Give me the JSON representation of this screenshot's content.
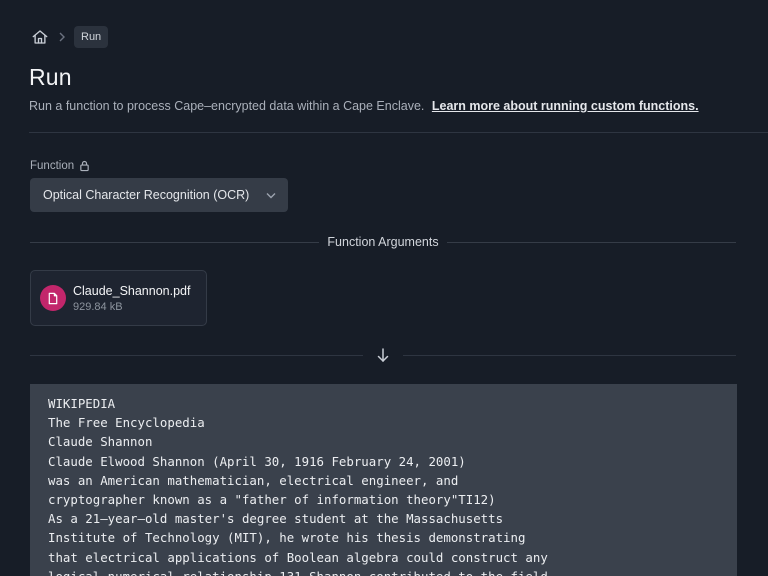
{
  "breadcrumb": {
    "current": "Run"
  },
  "header": {
    "title": "Run",
    "subtitle": "Run a function to process Cape–encrypted data within a Cape Enclave.",
    "learn_more_link": "Learn more about running custom functions."
  },
  "function_field": {
    "label": "Function",
    "selected": "Optical Character Recognition (OCR)"
  },
  "arguments": {
    "section_label": "Function Arguments",
    "file": {
      "name": "Claude_Shannon.pdf",
      "size": "929.84 kB"
    }
  },
  "output": {
    "lines": [
      "WIKIPEDIA",
      "The Free Encyclopedia",
      "Claude Shannon",
      "Claude Elwood Shannon (April 30, 1916 February 24, 2001)",
      "was an American mathematician, electrical engineer, and",
      "cryptographer known as a \"father of information theory\"TI12)",
      "As a 21–year–old master's degree student at the Massachusetts",
      "Institute of Technology (MIT), he wrote his thesis demonstrating",
      "that electrical applications of Boolean algebra could construct any",
      "logical numerical relationship.131 Shannon contributed to the field"
    ]
  },
  "icons": {
    "home": "home-icon",
    "breadcrumb_separator": "chevron-right-icon",
    "lock": "lock-icon",
    "dropdown": "chevron-down-icon",
    "file": "document-icon",
    "arrow": "arrow-down-icon"
  },
  "colors": {
    "background": "#171d27",
    "select_bg": "#353c47",
    "file_badge": "#c2266b",
    "output_bg": "#3a414c"
  }
}
